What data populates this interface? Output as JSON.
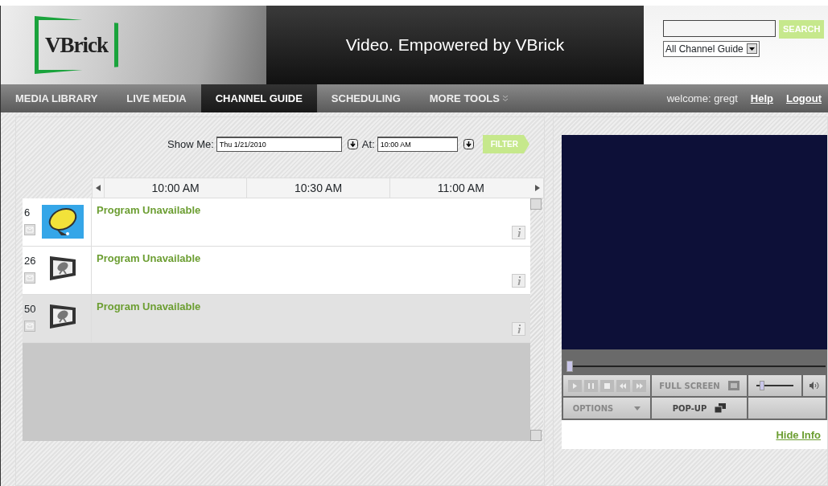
{
  "header": {
    "logo": "VBrick",
    "tagline": "Video. Empowered by VBrick",
    "search_button": "SEARCH",
    "scope_select": "All Channel Guide"
  },
  "nav": [
    {
      "label": "MEDIA LIBRARY",
      "selected": false,
      "menu": false
    },
    {
      "label": "LIVE MEDIA",
      "selected": false,
      "menu": false
    },
    {
      "label": "CHANNEL GUIDE",
      "selected": true,
      "menu": false
    },
    {
      "label": "SCHEDULING",
      "selected": false,
      "menu": false
    },
    {
      "label": "MORE TOOLS",
      "selected": false,
      "menu": true
    }
  ],
  "user": {
    "welcome": "welcome: gregt",
    "links": [
      "Help",
      "Logout"
    ]
  },
  "filter": {
    "show_me_label": "Show Me:",
    "date": "Thu 1/21/2010",
    "at_label": "At:",
    "time": "10:00 AM",
    "button": "FILTER"
  },
  "timeline": [
    "10:00 AM",
    "10:30 AM",
    "11:00 AM"
  ],
  "channels": [
    {
      "number": "6",
      "kind": "picture",
      "program": "Program Unavailable",
      "selected": false
    },
    {
      "number": "26",
      "kind": "tv",
      "program": "Program Unavailable",
      "selected": false
    },
    {
      "number": "50",
      "kind": "tv",
      "program": "Program Unavailable",
      "selected": true
    }
  ],
  "player": {
    "seek": {
      "level": 0.0
    },
    "volume": {
      "level": 0.1
    },
    "full_screen": "FULL SCREEN",
    "options": "OPTIONS",
    "popup": "POP-UP",
    "hide_info": "Hide Info"
  }
}
